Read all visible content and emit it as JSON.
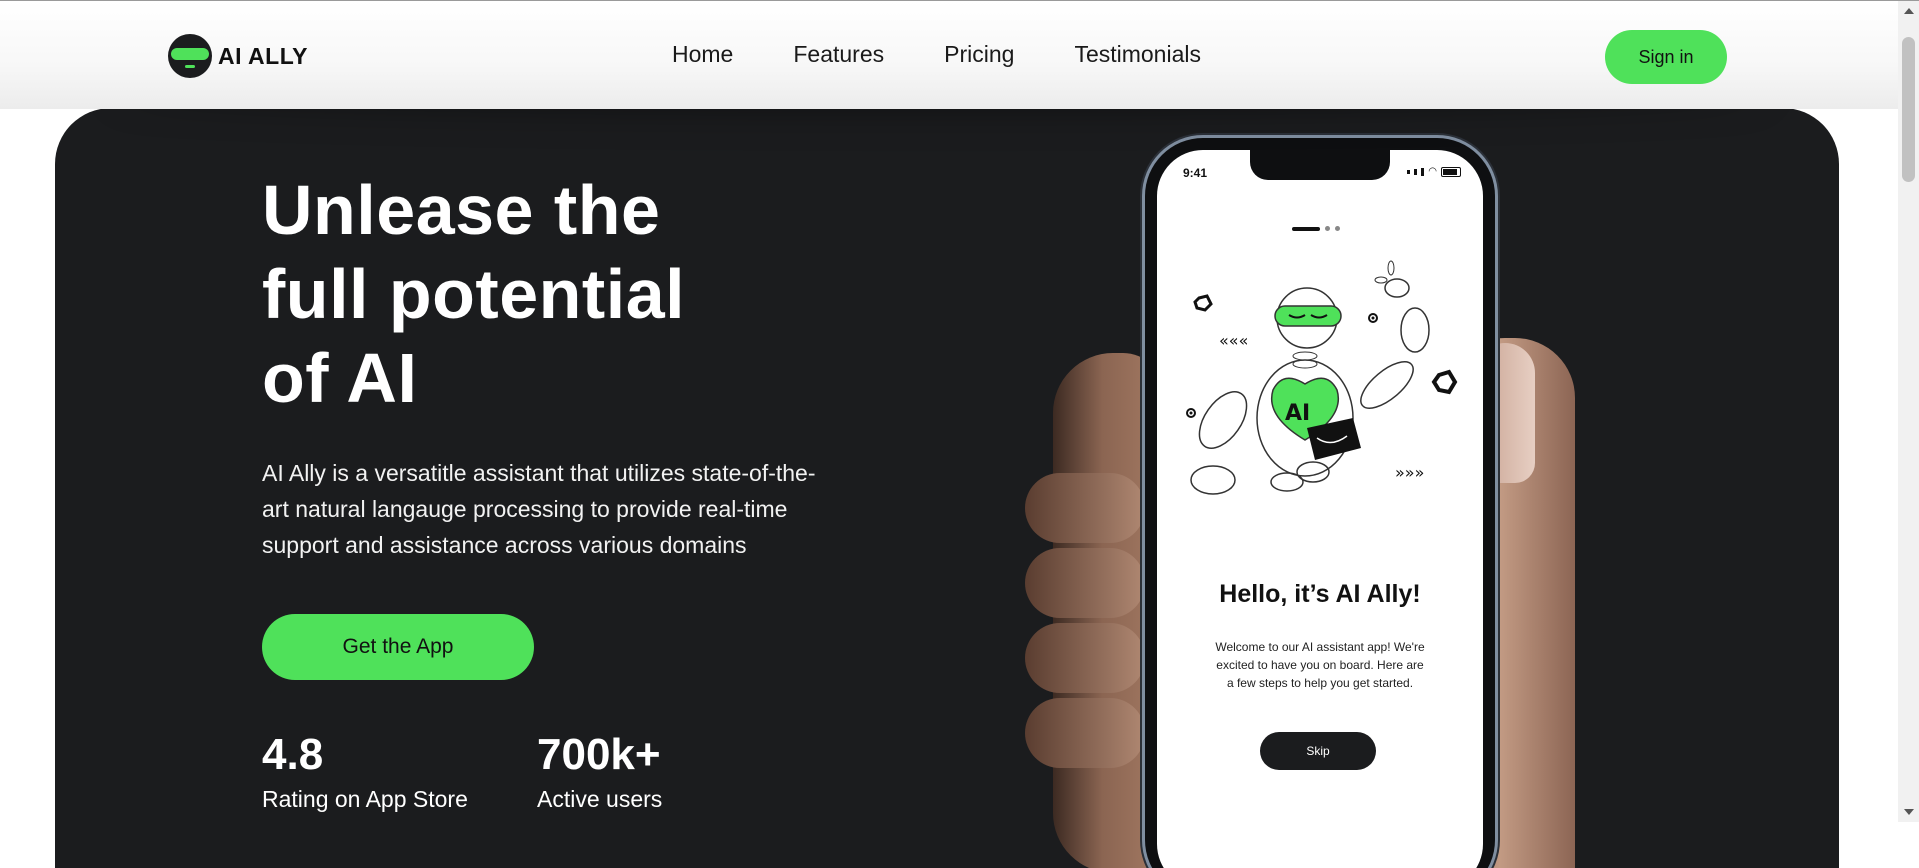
{
  "brand": {
    "name": "AI ALLY",
    "logo_icon": "robot-mascot-icon"
  },
  "nav": {
    "items": [
      {
        "label": "Home"
      },
      {
        "label": "Features"
      },
      {
        "label": "Pricing"
      },
      {
        "label": "Testimonials"
      }
    ]
  },
  "header": {
    "signin_label": "Sign in"
  },
  "hero": {
    "title_lines": [
      "Unlease the",
      "full potential",
      "of AI"
    ],
    "description": "AI Ally is a versatitle assistant that utilizes state-of-the-art natural langauge processing to provide real-time support and assistance across various domains",
    "cta_label": "Get the App",
    "stats": [
      {
        "value": "4.8",
        "label": "Rating on App Store"
      },
      {
        "value": "700k+",
        "label": "Active users"
      }
    ]
  },
  "phone": {
    "time": "9:41",
    "illustration_text": "AI",
    "title": "Hello, it’s AI Ally!",
    "text": "Welcome to our AI assistant app! We're excited to have you on board. Here are a few steps to help you get started.",
    "skip_label": "Skip"
  },
  "colors": {
    "accent": "#4fe15a",
    "dark": "#1b1c1e"
  }
}
